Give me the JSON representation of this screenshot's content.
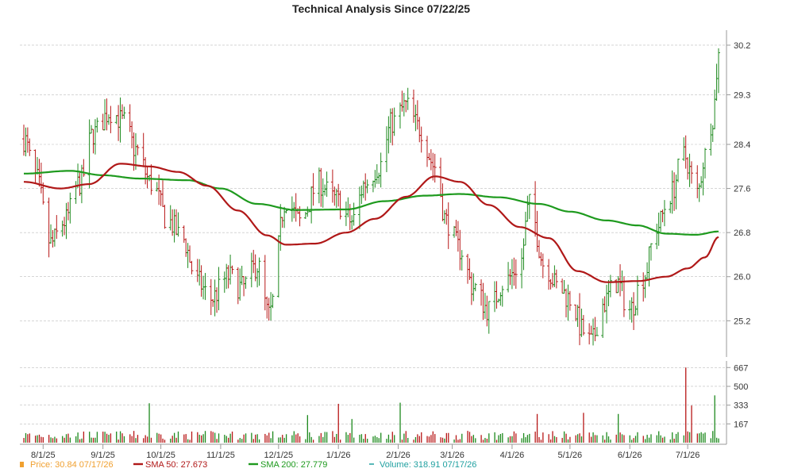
{
  "chart_data": {
    "type": "line",
    "title": "Technical Analysis Since 07/22/25",
    "price_axis": {
      "ylim": [
        24.6,
        30.3
      ],
      "ticks": [
        25.2,
        26.0,
        26.8,
        27.6,
        28.4,
        29.3,
        30.2
      ],
      "tick_labels": [
        "25.2",
        "26.0",
        "26.8",
        "27.6",
        "28.4",
        "29.3",
        "30.2"
      ]
    },
    "volume_axis": {
      "ylim": [
        0,
        690
      ],
      "ticks": [
        167,
        333,
        500,
        667
      ],
      "tick_labels": [
        "167",
        "333",
        "500",
        "667"
      ]
    },
    "x_axis": {
      "start": "2025-07-22",
      "end": "2026-07-17",
      "tick_dates": [
        "2025-08-01",
        "2025-09-01",
        "2025-10-01",
        "2025-11-01",
        "2025-12-01",
        "2026-01-01",
        "2026-02-01",
        "2026-03-01",
        "2026-04-01",
        "2026-05-01",
        "2026-06-01",
        "2026-07-01"
      ],
      "tick_labels": [
        "8/1/25",
        "9/1/25",
        "10/1/25",
        "11/1/25",
        "12/1/25",
        "1/1/26",
        "2/1/26",
        "3/1/26",
        "4/1/26",
        "5/1/26",
        "6/1/26",
        "7/1/26"
      ]
    },
    "price_keypoints": [
      [
        "2025-07-22",
        28.5
      ],
      [
        "2025-07-28",
        27.8
      ],
      [
        "2025-08-05",
        26.6
      ],
      [
        "2025-08-12",
        27.0
      ],
      [
        "2025-08-20",
        27.7
      ],
      [
        "2025-08-27",
        28.6
      ],
      [
        "2025-09-05",
        29.0
      ],
      [
        "2025-09-12",
        28.8
      ],
      [
        "2025-09-18",
        28.3
      ],
      [
        "2025-09-26",
        27.7
      ],
      [
        "2025-10-05",
        27.0
      ],
      [
        "2025-10-12",
        26.7
      ],
      [
        "2025-10-20",
        25.9
      ],
      [
        "2025-10-27",
        25.6
      ],
      [
        "2025-11-05",
        26.0
      ],
      [
        "2025-11-12",
        25.8
      ],
      [
        "2025-11-20",
        26.2
      ],
      [
        "2025-11-26",
        25.3
      ],
      [
        "2025-12-05",
        27.4
      ],
      [
        "2025-12-12",
        27.0
      ],
      [
        "2025-12-22",
        27.7
      ],
      [
        "2025-12-30",
        27.4
      ],
      [
        "2026-01-08",
        27.0
      ],
      [
        "2026-01-15",
        27.7
      ],
      [
        "2026-01-22",
        28.0
      ],
      [
        "2026-01-29",
        28.8
      ],
      [
        "2026-02-05",
        29.1
      ],
      [
        "2026-02-12",
        28.7
      ],
      [
        "2026-02-20",
        28.0
      ],
      [
        "2026-02-26",
        27.0
      ],
      [
        "2026-03-05",
        26.5
      ],
      [
        "2026-03-12",
        25.8
      ],
      [
        "2026-03-20",
        25.4
      ],
      [
        "2026-03-28",
        25.9
      ],
      [
        "2026-04-05",
        26.2
      ],
      [
        "2026-04-10",
        27.3
      ],
      [
        "2026-04-18",
        26.2
      ],
      [
        "2026-04-25",
        25.8
      ],
      [
        "2026-05-01",
        25.6
      ],
      [
        "2026-05-08",
        25.0
      ],
      [
        "2026-05-12",
        24.8
      ],
      [
        "2026-05-18",
        25.5
      ],
      [
        "2026-05-25",
        25.9
      ],
      [
        "2026-06-01",
        25.4
      ],
      [
        "2026-06-08",
        26.0
      ],
      [
        "2026-06-15",
        26.9
      ],
      [
        "2026-06-22",
        27.5
      ],
      [
        "2026-06-29",
        28.2
      ],
      [
        "2026-07-06",
        27.5
      ],
      [
        "2026-07-10",
        28.2
      ],
      [
        "2026-07-14",
        28.9
      ],
      [
        "2026-07-17",
        30.0
      ]
    ],
    "sma50_keypoints": [
      [
        "2025-07-22",
        27.72
      ],
      [
        "2025-08-10",
        27.6
      ],
      [
        "2025-08-25",
        27.68
      ],
      [
        "2025-09-10",
        28.05
      ],
      [
        "2025-09-25",
        28.0
      ],
      [
        "2025-10-10",
        27.9
      ],
      [
        "2025-10-25",
        27.65
      ],
      [
        "2025-11-10",
        27.2
      ],
      [
        "2025-11-25",
        26.75
      ],
      [
        "2025-12-05",
        26.58
      ],
      [
        "2025-12-20",
        26.6
      ],
      [
        "2026-01-05",
        26.8
      ],
      [
        "2026-01-20",
        27.05
      ],
      [
        "2026-02-05",
        27.45
      ],
      [
        "2026-02-20",
        27.82
      ],
      [
        "2026-03-05",
        27.72
      ],
      [
        "2026-03-20",
        27.3
      ],
      [
        "2026-04-05",
        26.9
      ],
      [
        "2026-04-20",
        26.7
      ],
      [
        "2026-05-05",
        26.1
      ],
      [
        "2026-05-20",
        25.9
      ],
      [
        "2026-06-05",
        25.92
      ],
      [
        "2026-06-20",
        26.0
      ],
      [
        "2026-07-01",
        26.15
      ],
      [
        "2026-07-10",
        26.35
      ],
      [
        "2026-07-17",
        26.72
      ]
    ],
    "sma200_keypoints": [
      [
        "2025-07-22",
        27.87
      ],
      [
        "2025-08-15",
        27.92
      ],
      [
        "2025-09-01",
        27.84
      ],
      [
        "2025-09-20",
        27.78
      ],
      [
        "2025-10-15",
        27.75
      ],
      [
        "2025-11-01",
        27.6
      ],
      [
        "2025-11-20",
        27.32
      ],
      [
        "2025-12-10",
        27.21
      ],
      [
        "2026-01-05",
        27.22
      ],
      [
        "2026-01-25",
        27.37
      ],
      [
        "2026-02-15",
        27.47
      ],
      [
        "2026-03-05",
        27.5
      ],
      [
        "2026-03-25",
        27.44
      ],
      [
        "2026-04-15",
        27.32
      ],
      [
        "2026-05-01",
        27.18
      ],
      [
        "2026-05-20",
        27.02
      ],
      [
        "2026-06-05",
        26.93
      ],
      [
        "2026-06-20",
        26.78
      ],
      [
        "2026-07-05",
        26.76
      ],
      [
        "2026-07-17",
        26.82
      ]
    ],
    "volume_spikes": [
      [
        "2025-09-25",
        350
      ],
      [
        "2025-12-16",
        245
      ],
      [
        "2026-01-01",
        345
      ],
      [
        "2026-01-08",
        210
      ],
      [
        "2026-02-02",
        355
      ],
      [
        "2026-03-14",
        245
      ],
      [
        "2026-04-14",
        255
      ],
      [
        "2026-05-08",
        265
      ],
      [
        "2026-05-26",
        255
      ],
      [
        "2026-06-30",
        667
      ],
      [
        "2026-07-03",
        330
      ],
      [
        "2026-07-15",
        420
      ]
    ],
    "legend": [
      {
        "name": "Price",
        "label": "Price: 30.84  07/17/26",
        "color": "#f0a030",
        "marker": "square"
      },
      {
        "name": "SMA 50",
        "label": "SMA 50: 27.673",
        "color": "#b01818",
        "marker": "line"
      },
      {
        "name": "SMA 200",
        "label": "SMA 200: 27.779",
        "color": "#1e9a1e",
        "marker": "line"
      },
      {
        "name": "Volume",
        "label": "Volume: 318.91  07/17/26",
        "color": "#20a0a0",
        "marker": "dash"
      }
    ],
    "colors": {
      "up": "#1e8a1e",
      "down": "#b81818",
      "sma50": "#b01818",
      "sma200": "#1e9a1e"
    },
    "grid": true,
    "legend_position": "bottom"
  }
}
